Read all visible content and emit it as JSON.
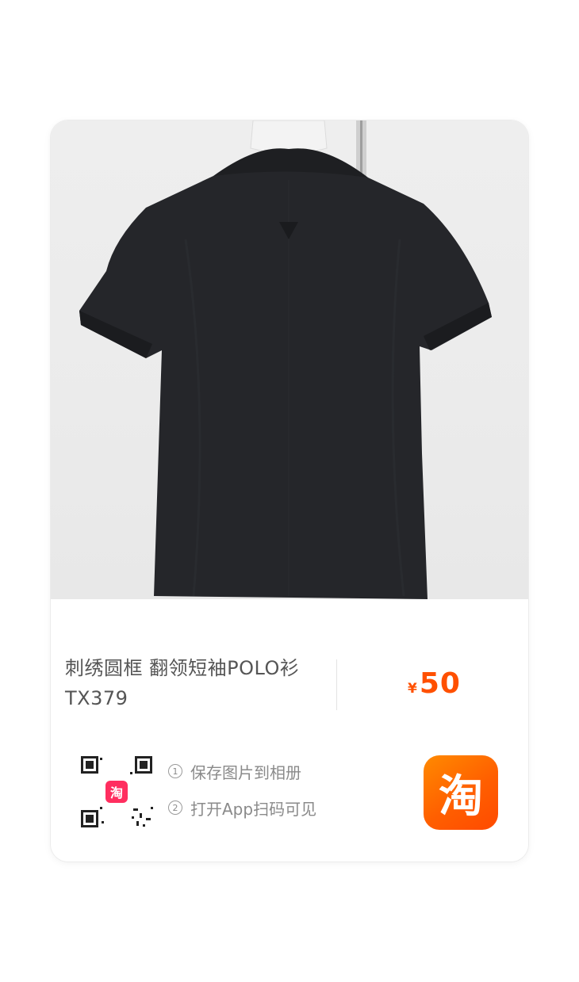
{
  "product": {
    "title_line1": "刺绣圆框 翻领短袖POLO衫",
    "title_line2": "TX379",
    "currency": "¥",
    "price": "50"
  },
  "qr_hint": {
    "step1_num": "1",
    "step1_text": "保存图片到相册",
    "step2_num": "2",
    "step2_text": "打开App扫码可见"
  },
  "app_icon": {
    "glyph": "淘",
    "qr_center_glyph": "淘"
  },
  "colors": {
    "accent": "#ff5000",
    "text": "#555555",
    "muted": "#8a8a8a"
  }
}
